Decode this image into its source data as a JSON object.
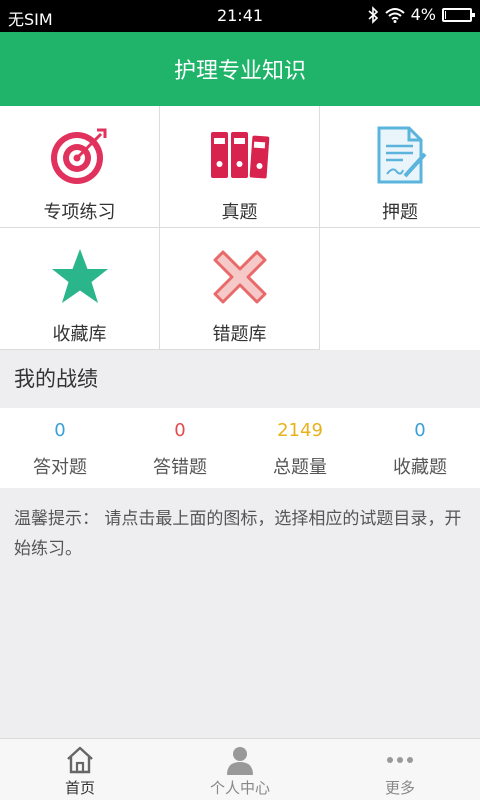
{
  "status": {
    "carrier": "无SIM",
    "time": "21:41",
    "battery": "4%",
    "battery_level": 0.04
  },
  "header": {
    "title": "护理专业知识"
  },
  "menu": [
    {
      "label": "专项练习",
      "icon": "target-icon"
    },
    {
      "label": "真题",
      "icon": "binders-icon"
    },
    {
      "label": "押题",
      "icon": "document-pen-icon"
    },
    {
      "label": "收藏库",
      "icon": "star-icon"
    },
    {
      "label": "错题库",
      "icon": "cross-icon"
    }
  ],
  "record": {
    "title": "我的战绩",
    "stats": [
      {
        "value": "0",
        "label": "答对题",
        "color": "#3aa0d8"
      },
      {
        "value": "0",
        "label": "答错题",
        "color": "#e24b4b"
      },
      {
        "value": "2149",
        "label": "总题量",
        "color": "#e8b21a"
      },
      {
        "value": "0",
        "label": "收藏题",
        "color": "#3aa0d8"
      }
    ]
  },
  "tip": {
    "text": "温馨提示： 请点击最上面的图标，选择相应的试题目录，开始练习。"
  },
  "tabs": [
    {
      "label": "首页",
      "icon": "home-icon",
      "active": true
    },
    {
      "label": "个人中心",
      "icon": "user-icon",
      "active": false
    },
    {
      "label": "更多",
      "icon": "more-icon",
      "active": false
    }
  ]
}
